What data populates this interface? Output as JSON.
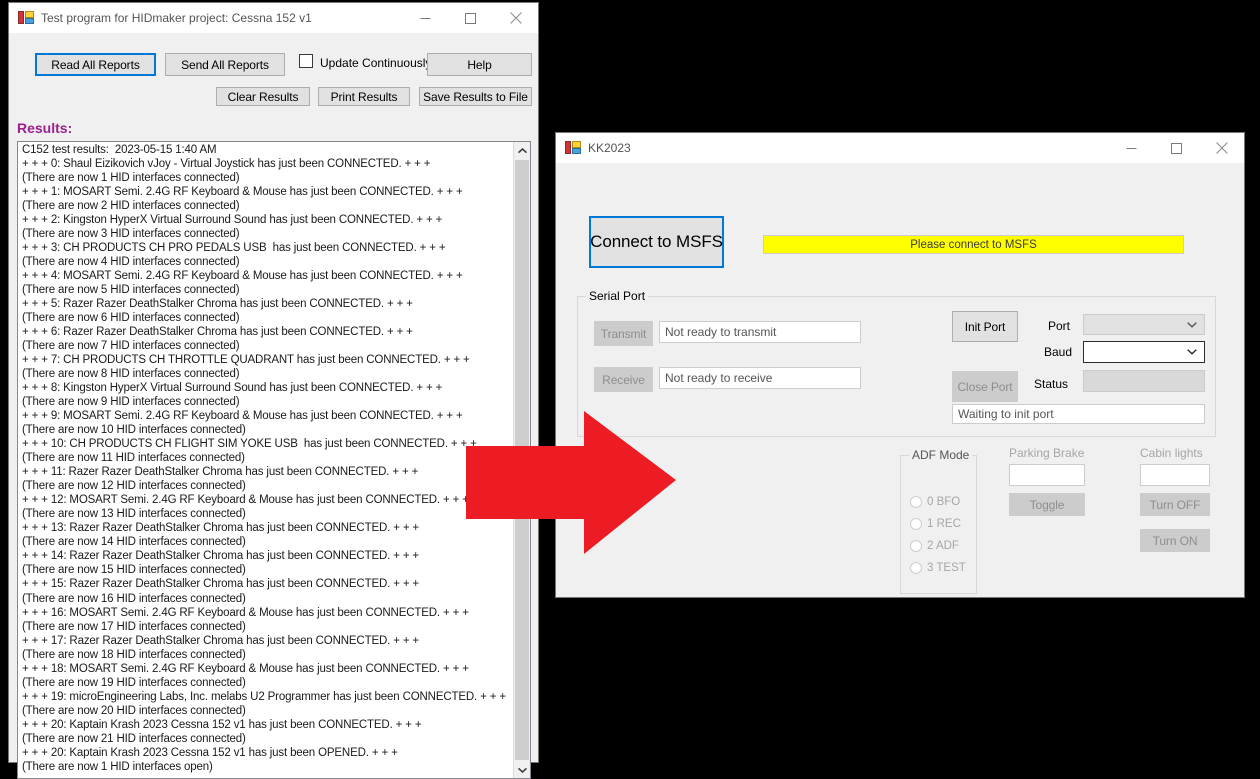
{
  "hidmaker_window": {
    "title": "Test program for HIDmaker project: Cessna 152 v1",
    "icon": "app-window-icon",
    "window_buttons": {
      "minimize": "minimize-icon",
      "maximize": "maximize-icon",
      "close": "close-icon"
    },
    "toolbar": {
      "read_all_reports": "Read All Reports",
      "send_all_reports": "Send All Reports",
      "update_continuously": "Update Continuously",
      "help": "Help",
      "clear_results": "Clear Results",
      "print_results": "Print Results",
      "save_results_to_file": "Save Results to File"
    },
    "results_label": "Results:",
    "results_text": "C152 test results:  2023-05-15 1:40 AM\n+ + + 0: Shaul Eizikovich vJoy - Virtual Joystick has just been CONNECTED. + + +\n(There are now 1 HID interfaces connected)\n+ + + 1: MOSART Semi. 2.4G RF Keyboard & Mouse has just been CONNECTED. + + +\n(There are now 2 HID interfaces connected)\n+ + + 2: Kingston HyperX Virtual Surround Sound has just been CONNECTED. + + +\n(There are now 3 HID interfaces connected)\n+ + + 3: CH PRODUCTS CH PRO PEDALS USB  has just been CONNECTED. + + +\n(There are now 4 HID interfaces connected)\n+ + + 4: MOSART Semi. 2.4G RF Keyboard & Mouse has just been CONNECTED. + + +\n(There are now 5 HID interfaces connected)\n+ + + 5: Razer Razer DeathStalker Chroma has just been CONNECTED. + + +\n(There are now 6 HID interfaces connected)\n+ + + 6: Razer Razer DeathStalker Chroma has just been CONNECTED. + + +\n(There are now 7 HID interfaces connected)\n+ + + 7: CH PRODUCTS CH THROTTLE QUADRANT has just been CONNECTED. + + +\n(There are now 8 HID interfaces connected)\n+ + + 8: Kingston HyperX Virtual Surround Sound has just been CONNECTED. + + +\n(There are now 9 HID interfaces connected)\n+ + + 9: MOSART Semi. 2.4G RF Keyboard & Mouse has just been CONNECTED. + + +\n(There are now 10 HID interfaces connected)\n+ + + 10: CH PRODUCTS CH FLIGHT SIM YOKE USB  has just been CONNECTED. + + +\n(There are now 11 HID interfaces connected)\n+ + + 11: Razer Razer DeathStalker Chroma has just been CONNECTED. + + +\n(There are now 12 HID interfaces connected)\n+ + + 12: MOSART Semi. 2.4G RF Keyboard & Mouse has just been CONNECTED. + + +\n(There are now 13 HID interfaces connected)\n+ + + 13: Razer Razer DeathStalker Chroma has just been CONNECTED. + + +\n(There are now 14 HID interfaces connected)\n+ + + 14: Razer Razer DeathStalker Chroma has just been CONNECTED. + + +\n(There are now 15 HID interfaces connected)\n+ + + 15: Razer Razer DeathStalker Chroma has just been CONNECTED. + + +\n(There are now 16 HID interfaces connected)\n+ + + 16: MOSART Semi. 2.4G RF Keyboard & Mouse has just been CONNECTED. + + +\n(There are now 17 HID interfaces connected)\n+ + + 17: Razer Razer DeathStalker Chroma has just been CONNECTED. + + +\n(There are now 18 HID interfaces connected)\n+ + + 18: MOSART Semi. 2.4G RF Keyboard & Mouse has just been CONNECTED. + + +\n(There are now 19 HID interfaces connected)\n+ + + 19: microEngineering Labs, Inc. melabs U2 Programmer has just been CONNECTED. + + +\n(There are now 20 HID interfaces connected)\n+ + + 20: Kaptain Krash 2023 Cessna 152 v1 has just been CONNECTED. + + +\n(There are now 21 HID interfaces connected)\n+ + + 20: Kaptain Krash 2023 Cessna 152 v1 has just been OPENED. + + +\n(There are now 1 HID interfaces open)",
    "scrollbar": {
      "up": "scroll-up-icon",
      "down": "scroll-down-icon"
    }
  },
  "kk2023_window": {
    "title": "KK2023",
    "icon": "app-window-icon",
    "window_buttons": {
      "minimize": "minimize-icon",
      "maximize": "maximize-icon",
      "close": "close-icon"
    },
    "connect_button": "Connect to MSFS",
    "connect_status": "Please connect to MSFS",
    "connect_status_color": "#ffff00",
    "serial_port": {
      "group_title": "Serial Port",
      "transmit_button": "Transmit",
      "transmit_status": "Not ready to transmit",
      "receive_button": "Receive",
      "receive_status": "Not ready to receive",
      "init_port_button": "Init Port",
      "close_port_button": "Close Port",
      "port_label": "Port",
      "port_value": "",
      "baud_label": "Baud",
      "baud_value": "",
      "status_label": "Status",
      "status_value": "",
      "port_status_message": "Waiting to init port"
    },
    "adf_mode": {
      "group_title": "ADF Mode",
      "options": [
        "0 BFO",
        "1 REC",
        "2 ADF",
        "3 TEST"
      ]
    },
    "parking_brake": {
      "label": "Parking Brake",
      "value": "",
      "toggle_button": "Toggle"
    },
    "cabin_lights": {
      "label": "Cabin lights",
      "value": "",
      "turn_off_button": "Turn OFF",
      "turn_on_button": "Turn ON"
    }
  },
  "annotation": {
    "arrow": "red-right-arrow",
    "arrow_color": "#ed1c24"
  }
}
